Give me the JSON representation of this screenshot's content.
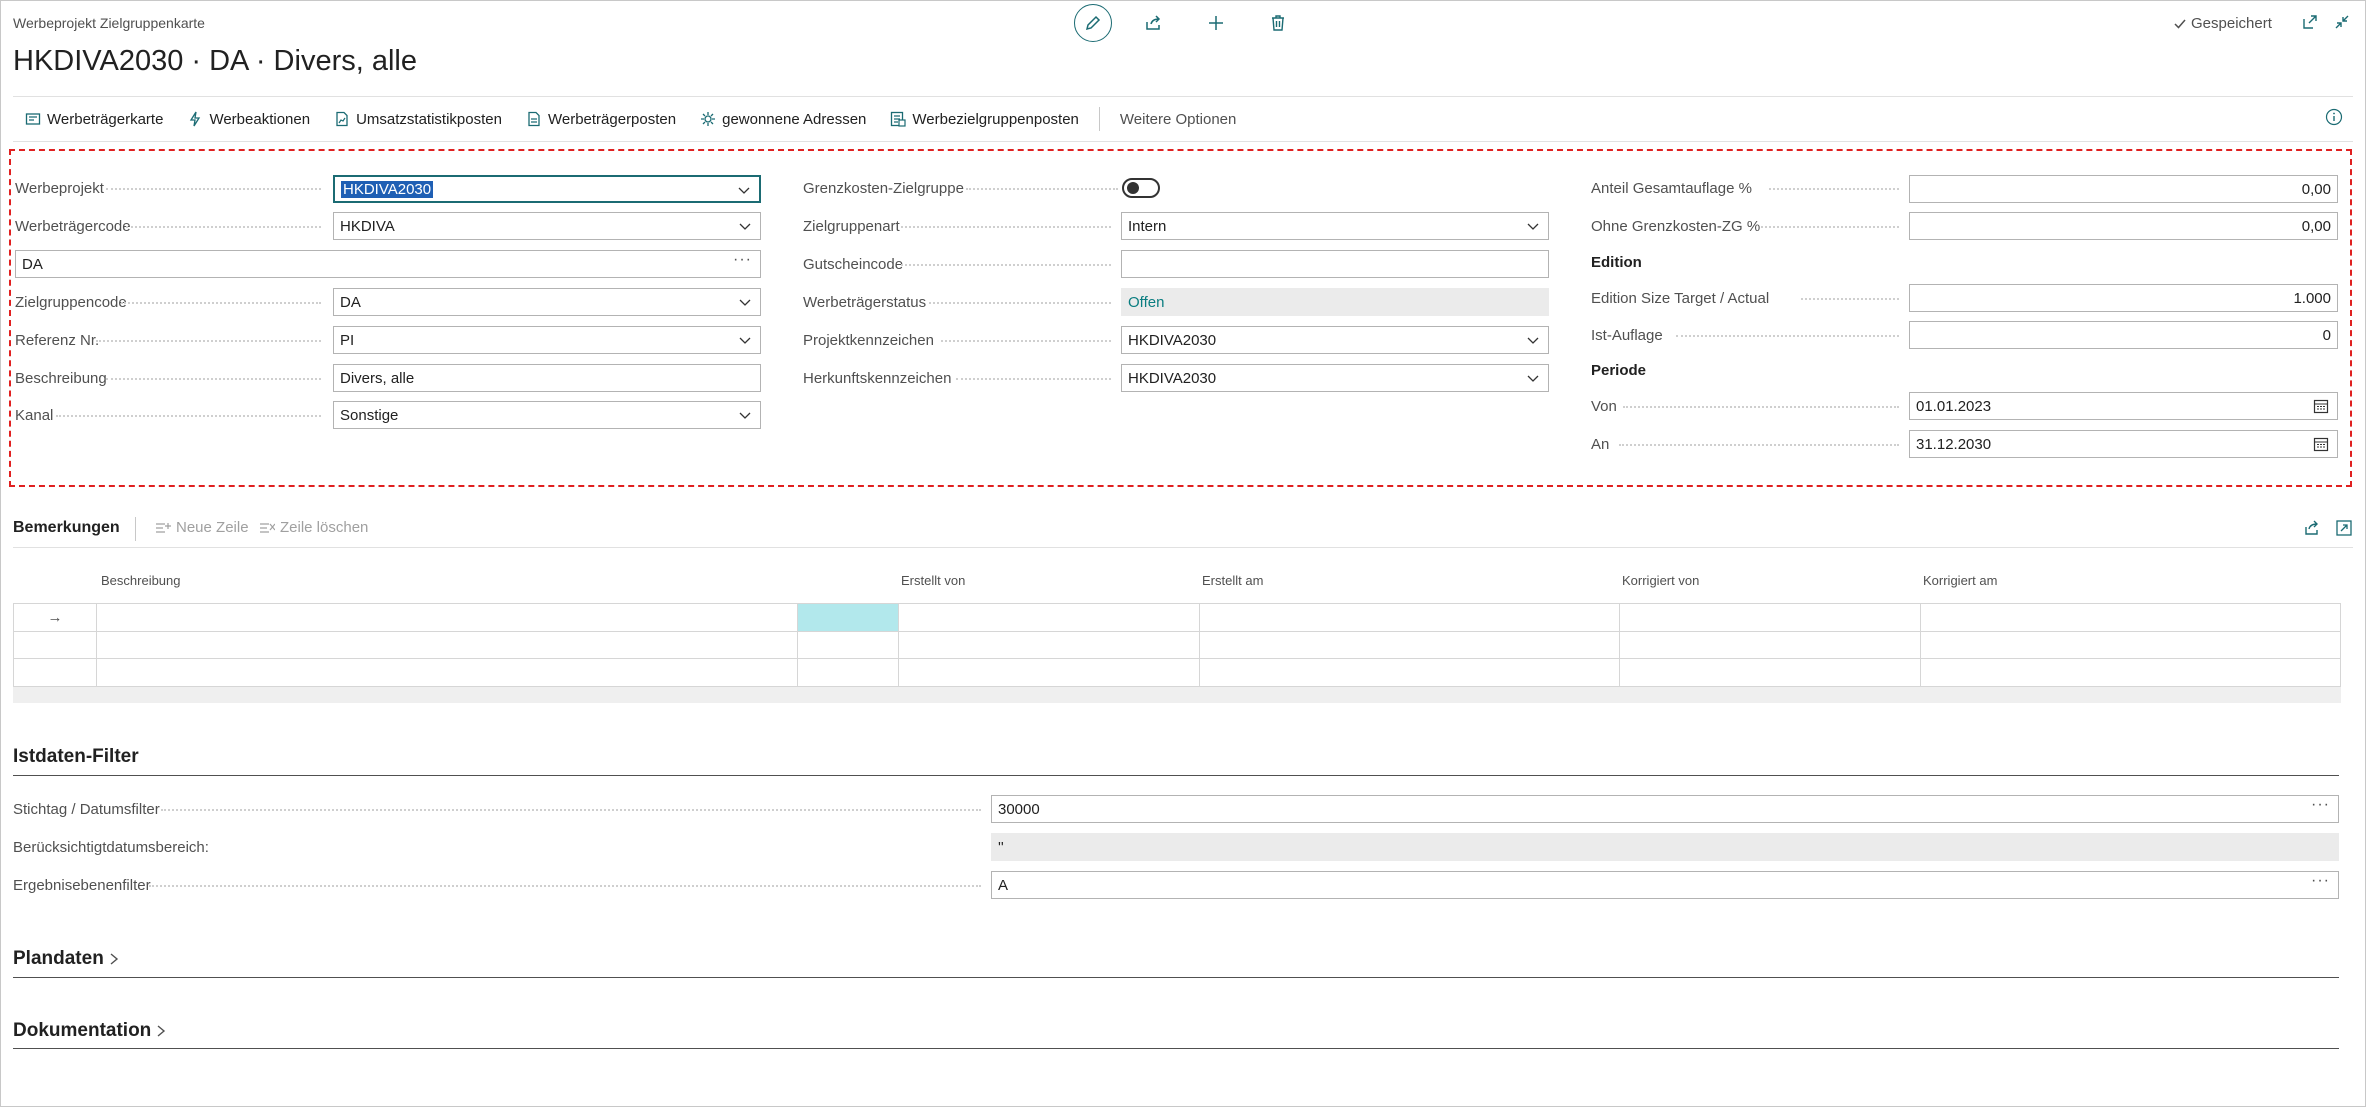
{
  "header": {
    "breadcrumb": "Werbeprojekt Zielgruppenkarte",
    "title": "HKDIVA2030 · DA · Divers, alle",
    "saved_label": "Gespeichert",
    "toolbar_icons": [
      "pencil-icon",
      "share-icon",
      "plus-icon",
      "trash-icon"
    ],
    "right_icons": [
      "open-new-window-icon",
      "collapse-icon"
    ]
  },
  "actions": {
    "items": [
      {
        "label": "Werbeträgerkarte",
        "icon": "card-icon"
      },
      {
        "label": "Werbeaktionen",
        "icon": "lightning-icon"
      },
      {
        "label": "Umsatzstatistikposten",
        "icon": "chart-doc-icon"
      },
      {
        "label": "Werbeträgerposten",
        "icon": "document-icon"
      },
      {
        "label": "gewonnene Adressen",
        "icon": "gear-icon"
      },
      {
        "label": "Werbezielgruppenposten",
        "icon": "list-doc-icon"
      }
    ],
    "more_label": "Weitere Optionen"
  },
  "general": {
    "col1": {
      "werbeprojekt": {
        "label": "Werbeprojekt",
        "value": "HKDIVA2030"
      },
      "werbetraegercode": {
        "label": "Werbeträgercode",
        "value": "HKDIVA"
      },
      "da_field": {
        "value": "DA"
      },
      "zielgruppencode": {
        "label": "Zielgruppencode",
        "value": "DA"
      },
      "referenz": {
        "label": "Referenz Nr.",
        "value": "PI"
      },
      "beschreibung": {
        "label": "Beschreibung",
        "value": "Divers, alle"
      },
      "kanal": {
        "label": "Kanal",
        "value": "Sonstige"
      }
    },
    "col2": {
      "grenzkosten": {
        "label": "Grenzkosten-Zielgruppe",
        "value": false
      },
      "zielgruppenart": {
        "label": "Zielgruppenart",
        "value": "Intern"
      },
      "gutscheincode": {
        "label": "Gutscheincode",
        "value": ""
      },
      "status": {
        "label": "Werbeträgerstatus",
        "value": "Offen"
      },
      "projektkennzeichen": {
        "label": "Projektkennzeichen",
        "value": "HKDIVA2030"
      },
      "herkunftskennzeichen": {
        "label": "Herkunftskennzeichen",
        "value": "HKDIVA2030"
      }
    },
    "col3": {
      "anteil": {
        "label": "Anteil Gesamtauflage %",
        "value": "0,00"
      },
      "ohne_grenzkosten": {
        "label": "Ohne Grenzkosten-ZG %",
        "value": "0,00"
      },
      "edition_heading": "Edition",
      "edition_size": {
        "label": "Edition Size Target / Actual",
        "value": "1.000"
      },
      "ist_auflage": {
        "label": "Ist-Auflage",
        "value": "0"
      },
      "periode_heading": "Periode",
      "von": {
        "label": "Von",
        "value": "01.01.2023"
      },
      "an": {
        "label": "An",
        "value": "31.12.2030"
      }
    }
  },
  "bemerkungen": {
    "title": "Bemerkungen",
    "new_line": "Neue Zeile",
    "delete_line": "Zeile löschen",
    "columns": [
      "Beschreibung",
      "Erstellt von",
      "Erstellt am",
      "Korrigiert von",
      "Korrigiert am"
    ],
    "row_marker": "→"
  },
  "istdaten": {
    "title": "Istdaten-Filter",
    "stichtag": {
      "label": "Stichtag / Datumsfilter",
      "value": "30000"
    },
    "beruecksichtigt": {
      "label": "Berücksichtigtdatumsbereich:",
      "value": "''"
    },
    "ergebnisebene": {
      "label": "Ergebnisebenenfilter",
      "value": "A"
    }
  },
  "plandaten": {
    "title": "Plandaten"
  },
  "dokumentation": {
    "title": "Dokumentation"
  },
  "colors": {
    "accent": "#1b6b73",
    "selection": "#1f5fb4",
    "highlight_cell": "#b2e8ec",
    "focus_border": "#e02020"
  }
}
